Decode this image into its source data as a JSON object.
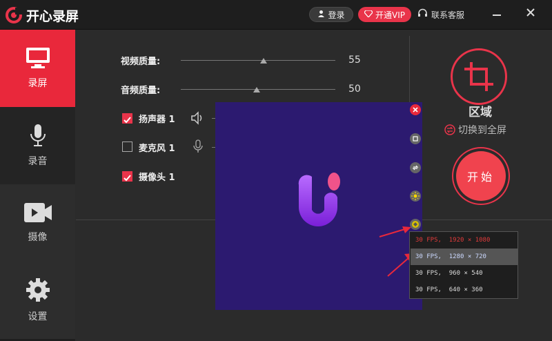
{
  "app": {
    "title": "开心录屏"
  },
  "header": {
    "login_label": "登录",
    "vip_label": "开通VIP",
    "service_label": "联系客服",
    "minimize_icon": "minimize-icon",
    "close_icon": "close-icon"
  },
  "sidebar": {
    "items": [
      {
        "label": "录屏",
        "icon": "monitor-icon",
        "active": true
      },
      {
        "label": "录音",
        "icon": "microphone-icon",
        "active": false
      },
      {
        "label": "摄像",
        "icon": "video-camera-icon",
        "active": false
      },
      {
        "label": "设置",
        "icon": "gear-icon",
        "active": false
      }
    ]
  },
  "settings": {
    "video_quality": {
      "label": "视频质量:",
      "value": "55"
    },
    "audio_quality": {
      "label": "音频质量:",
      "value": "50"
    },
    "speaker": {
      "label": "扬声器 1",
      "checked": true
    },
    "microphone": {
      "label": "麦克风 1",
      "checked": false
    },
    "camera": {
      "label": "摄像头 1",
      "checked": true
    }
  },
  "region": {
    "label": "区域",
    "switch_label": "切换到全屏",
    "start_label": "开始"
  },
  "resolution_menu": {
    "items": [
      {
        "text": "30 FPS,  1920 × 1080",
        "color": "#e23b3b"
      },
      {
        "text": "30 FPS,  1280 × 720",
        "color": "#dddddd",
        "highlighted": true
      },
      {
        "text": "30 FPS,  960 × 540",
        "color": "#dddddd"
      },
      {
        "text": "30 FPS,  640 × 360",
        "color": "#dddddd"
      }
    ]
  },
  "colors": {
    "accent": "#e9344a",
    "preview_bg": "#2c1a70"
  }
}
